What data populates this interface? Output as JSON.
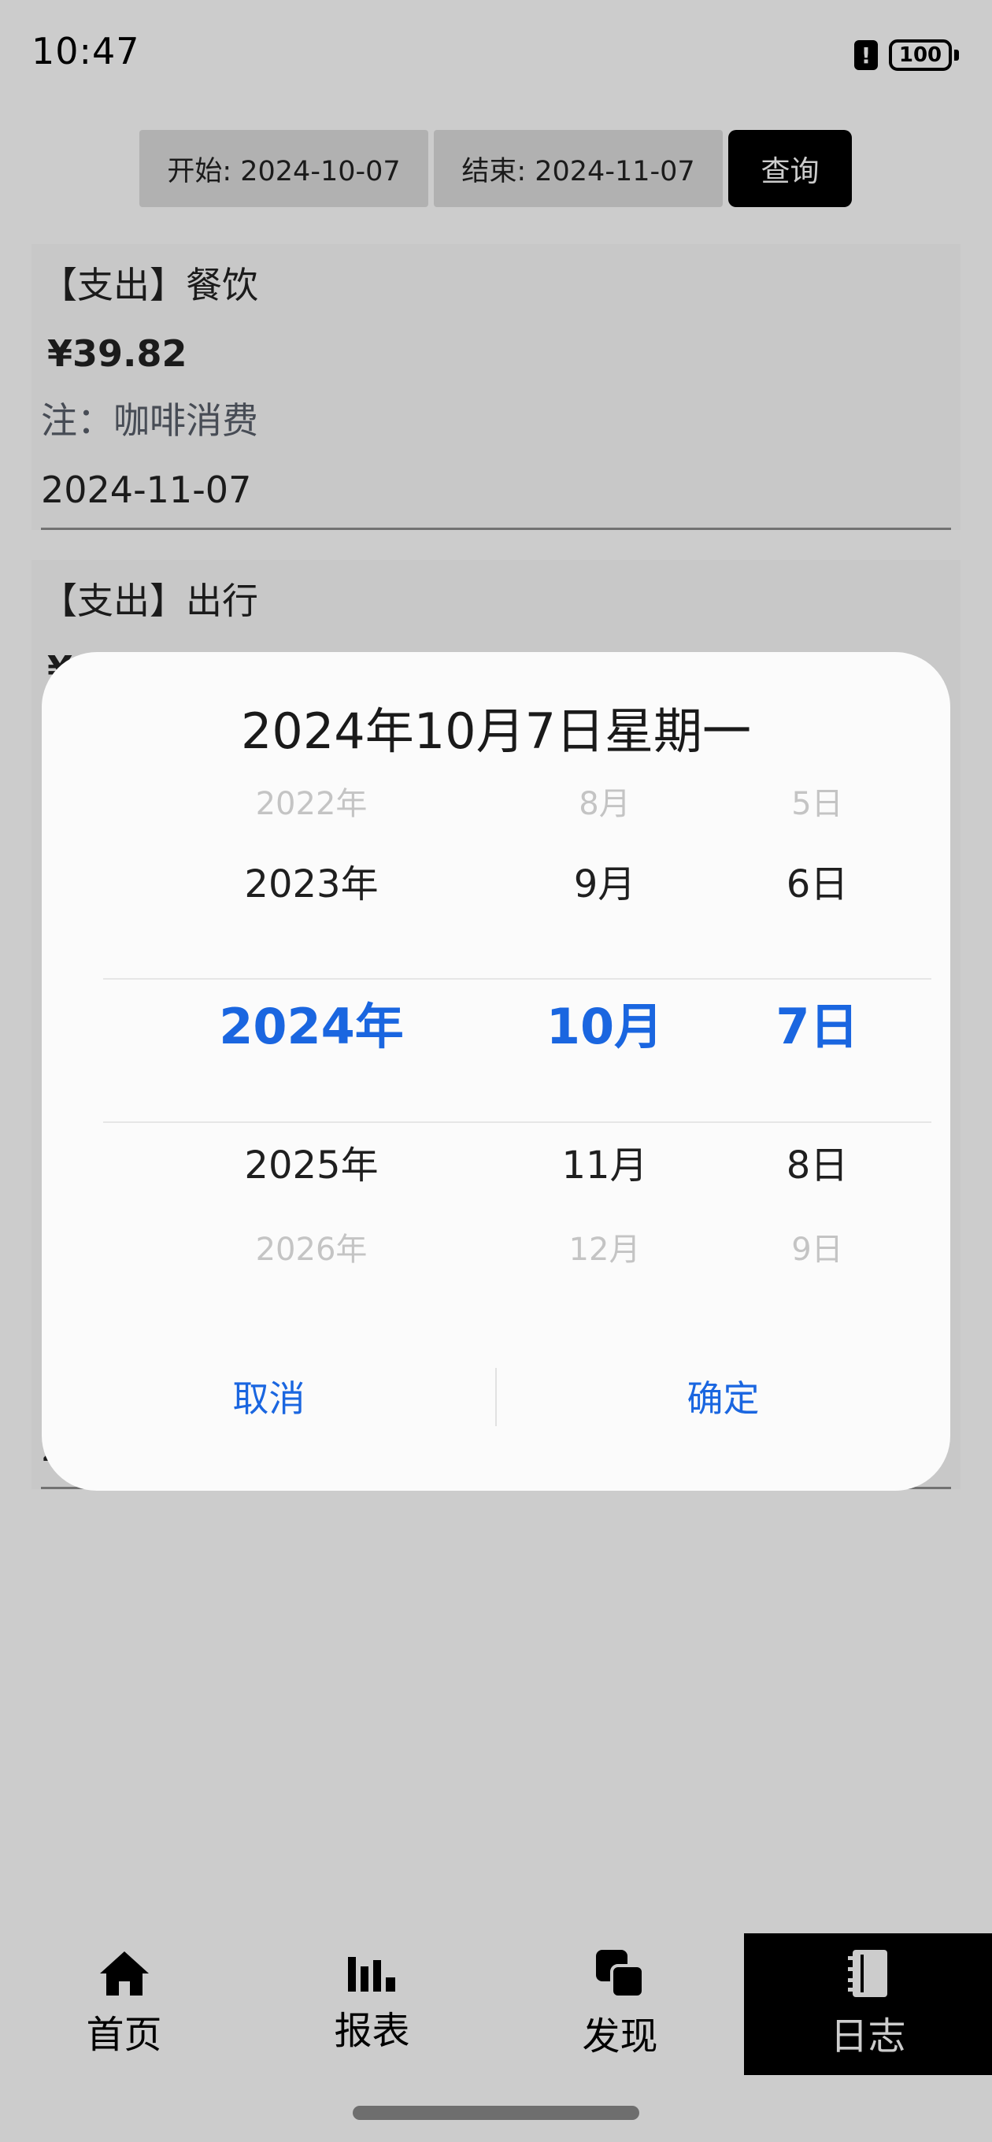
{
  "status": {
    "time": "10:47",
    "battery": "100"
  },
  "filter": {
    "start_label": "开始: 2024-10-07",
    "end_label": "结束: 2024-11-07",
    "query_label": "查询"
  },
  "records": [
    {
      "title": "【支出】餐饮",
      "amount": "¥39.82",
      "note": "注：咖啡消费",
      "date": "2024-11-07"
    },
    {
      "title": "【支出】出行",
      "amount": "¥",
      "note": "",
      "date": "2"
    }
  ],
  "dialog": {
    "title": "2024年10月7日星期一",
    "years": [
      "2022年",
      "2023年",
      "2024年",
      "2025年",
      "2026年"
    ],
    "months": [
      "8月",
      "9月",
      "10月",
      "11月",
      "12月"
    ],
    "days": [
      "5日",
      "6日",
      "7日",
      "8日",
      "9日"
    ],
    "cancel_label": "取消",
    "confirm_label": "确定"
  },
  "tabs": [
    {
      "label": "首页",
      "icon": "home-icon",
      "active": false
    },
    {
      "label": "报表",
      "icon": "bar-chart-icon",
      "active": false
    },
    {
      "label": "发现",
      "icon": "discover-icon",
      "active": false
    },
    {
      "label": "日志",
      "icon": "notebook-icon",
      "active": true
    }
  ],
  "colors": {
    "accent": "#1a66e0",
    "active_tab": "#000000",
    "overlay": "rgba(0,0,0,0.2)"
  }
}
